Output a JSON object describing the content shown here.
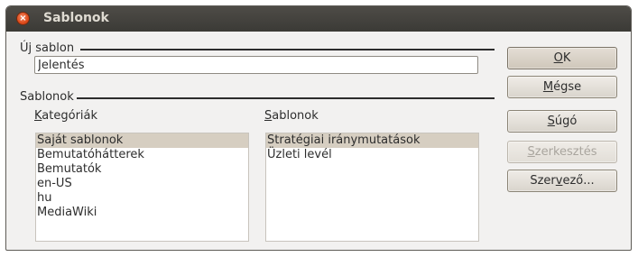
{
  "window": {
    "title": "Sablonok",
    "close_glyph": "×"
  },
  "new_template": {
    "section_label": "Új sablon",
    "name_value": "Jelentés"
  },
  "templates": {
    "section_label": "Sablonok",
    "categories": {
      "label_accel": "K",
      "label_rest": "ategóriák",
      "items": [
        "Saját sablonok",
        "Bemutatóhátterek",
        "Bemutatók",
        "en-US",
        "hu",
        "MediaWiki"
      ],
      "selected_index": 0
    },
    "list": {
      "label_accel": "S",
      "label_rest": "ablonok",
      "items": [
        "Stratégiai iránymutatások",
        "Üzleti levél"
      ],
      "selected_index": 0
    }
  },
  "buttons": {
    "ok": {
      "accel": "O",
      "rest": "K"
    },
    "cancel": {
      "accel": "M",
      "rest": "égse"
    },
    "help": {
      "accel": "S",
      "rest": "úgó"
    },
    "edit": {
      "accel": "S",
      "rest": "zerkesztés"
    },
    "organizer": {
      "pre": "Szer",
      "accel": "v",
      "rest": "ező..."
    }
  },
  "colors": {
    "titlebar": "#3c3b37",
    "selection": "#d6cec1",
    "background": "#f2f1f0"
  }
}
